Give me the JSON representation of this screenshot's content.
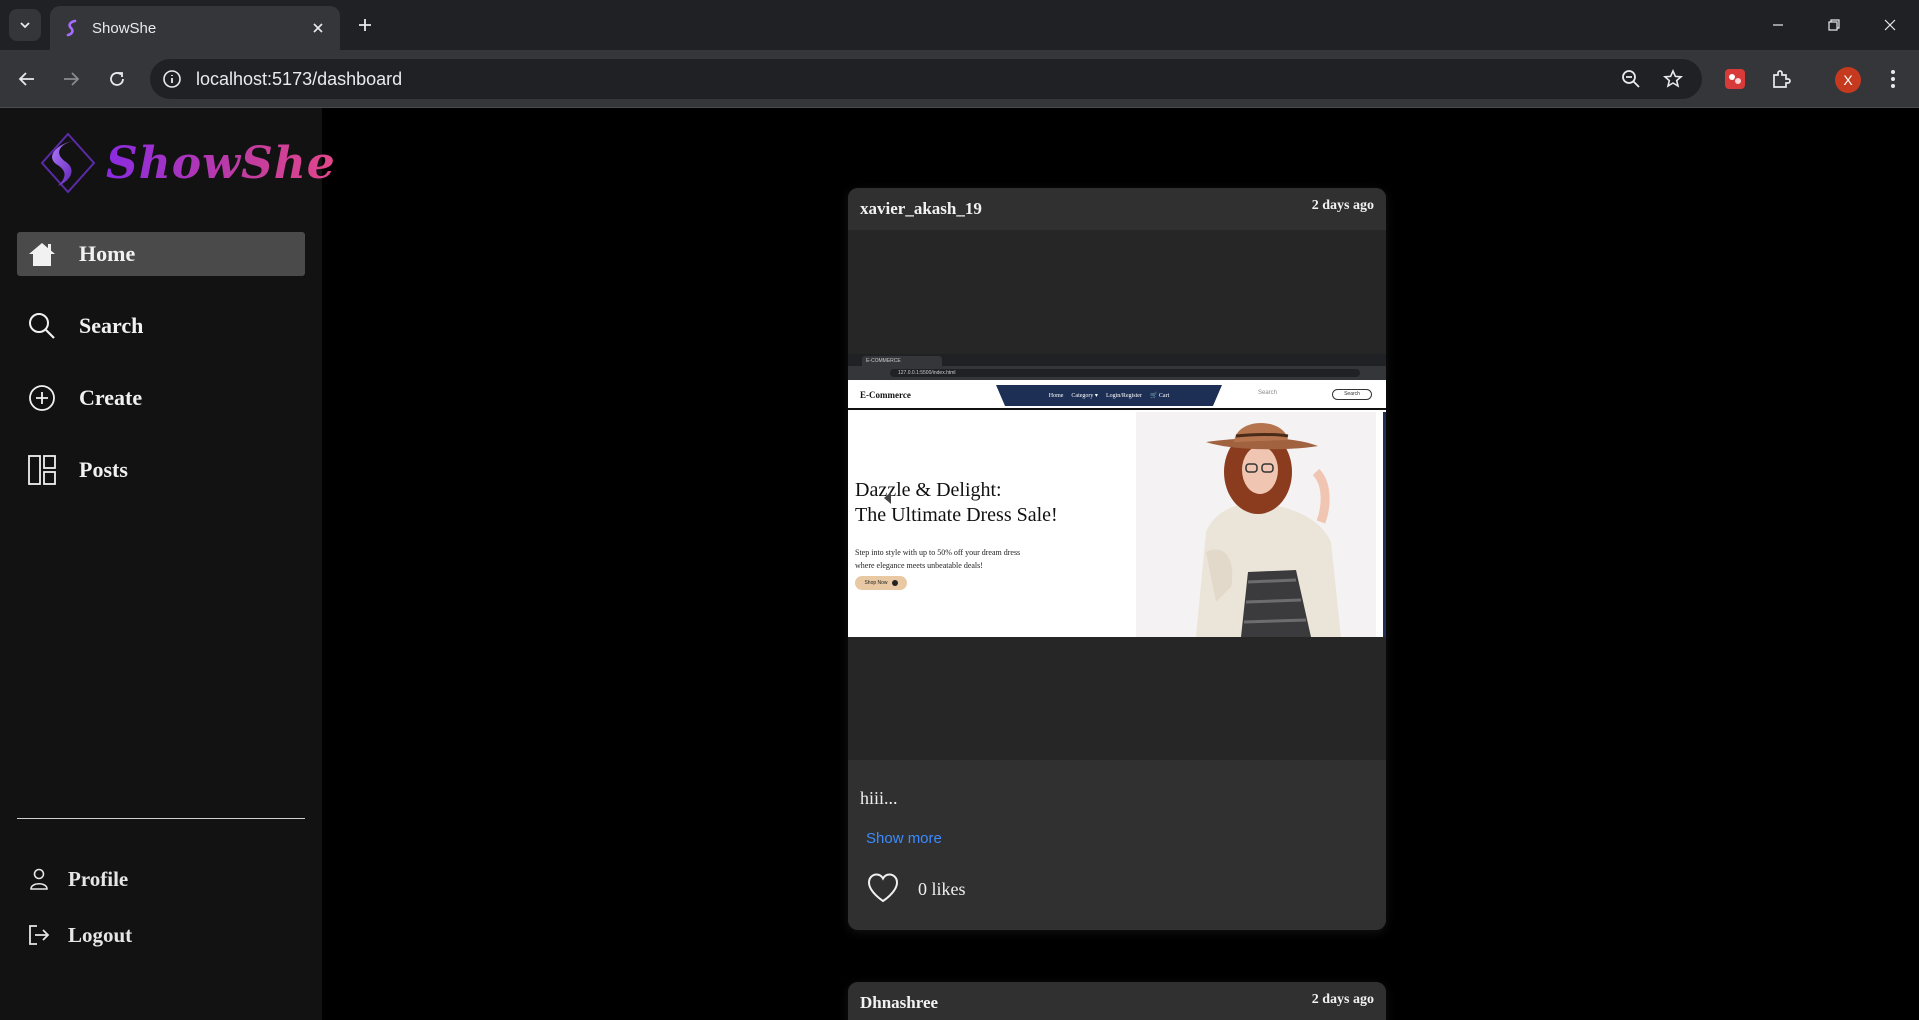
{
  "browser": {
    "tab_title": "ShowShe",
    "url": "localhost:5173/dashboard",
    "profile_initial": "X"
  },
  "app": {
    "brand": "ShowShe",
    "nav": [
      {
        "label": "Home",
        "icon": "home-icon",
        "active": true
      },
      {
        "label": "Search",
        "icon": "search-icon",
        "active": false
      },
      {
        "label": "Create",
        "icon": "plus-circle-icon",
        "active": false
      },
      {
        "label": "Posts",
        "icon": "grid-icon",
        "active": false
      }
    ],
    "bottom_nav": [
      {
        "label": "Profile",
        "icon": "user-icon"
      },
      {
        "label": "Logout",
        "icon": "logout-icon"
      }
    ]
  },
  "feed": {
    "posts": [
      {
        "username": "xavier_akash_19",
        "time": "2 days ago",
        "caption": "hiii...",
        "show_more": "Show more",
        "likes": "0 likes",
        "image": {
          "tab_title": "E-COMMERCE",
          "url": "127.0.0.1:5500/index.html",
          "brand": "E-Commerce",
          "menu": [
            "Home",
            "Category ▾",
            "Login/Register",
            "🛒 Cart"
          ],
          "search_placeholder": "Search",
          "search_button": "Search",
          "headline_1": "Dazzle & Delight:",
          "headline_2": "The Ultimate Dress Sale!",
          "sub_1": "Step into style with up to 50% off your dream dress",
          "sub_2": "where elegance meets unbeatable deals!",
          "cta": "Shop Now"
        }
      },
      {
        "username": "Dhnashree",
        "time": "2 days ago"
      }
    ]
  },
  "colors": {
    "brand_gradient_start": "#8a2be2",
    "brand_gradient_end": "#e4468a",
    "link": "#3b8bff",
    "active_nav": "#4a4a4a"
  }
}
